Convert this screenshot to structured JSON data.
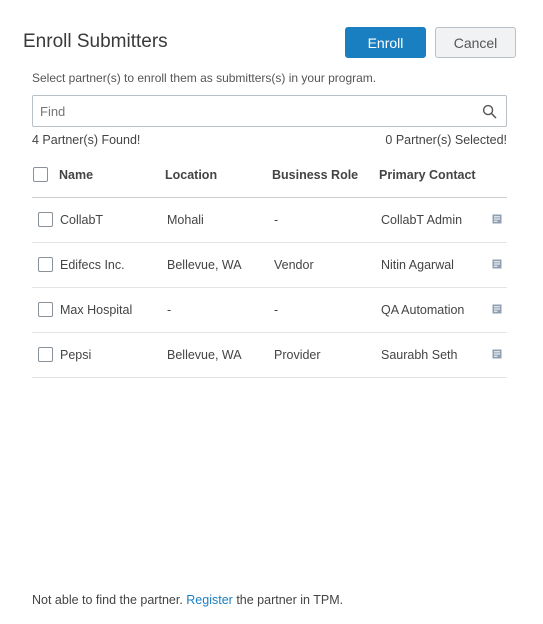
{
  "dialog": {
    "title": "Enroll Submitters",
    "enroll_label": "Enroll",
    "cancel_label": "Cancel",
    "instruction": "Select partner(s) to enroll them as submitters(s) in your program."
  },
  "search": {
    "placeholder": "Find",
    "value": ""
  },
  "counts": {
    "found": "4 Partner(s) Found!",
    "selected": "0 Partner(s) Selected!"
  },
  "table": {
    "headers": {
      "name": "Name",
      "location": "Location",
      "role": "Business Role",
      "contact": "Primary Contact"
    },
    "rows": [
      {
        "name": "CollabT",
        "location": "Mohali",
        "role": "-",
        "contact": "CollabT Admin"
      },
      {
        "name": "Edifecs Inc.",
        "location": "Bellevue, WA",
        "role": "Vendor",
        "contact": "Nitin Agarwal"
      },
      {
        "name": "Max Hospital",
        "location": "-",
        "role": "-",
        "contact": "QA Automation"
      },
      {
        "name": "Pepsi",
        "location": "Bellevue, WA",
        "role": "Provider",
        "contact": "Saurabh Seth"
      }
    ]
  },
  "footer": {
    "prefix": "Not able to find the partner.",
    "link": "Register",
    "suffix": "the partner in TPM."
  },
  "colors": {
    "accent": "#1a7fc1",
    "border": "#b9c0c6",
    "text": "#444444"
  },
  "icons": {
    "search": "search-icon",
    "contact": "contact-card-icon"
  }
}
